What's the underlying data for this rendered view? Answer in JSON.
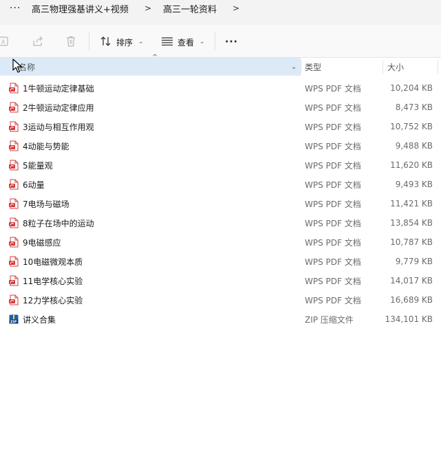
{
  "breadcrumb": {
    "more_label": "···",
    "items": [
      "高三物理强基讲义+视频",
      "高三一轮资料"
    ],
    "separator": ">"
  },
  "toolbar": {
    "sort_label": "排序",
    "view_label": "查看",
    "more_label": "···"
  },
  "columns": {
    "name": "名称",
    "type": "类型",
    "size": "大小"
  },
  "files": [
    {
      "name": "1牛顿运动定律基础",
      "type": "WPS PDF 文档",
      "size": "10,204 KB",
      "icon": "pdf-icon"
    },
    {
      "name": "2牛顿运动定律应用",
      "type": "WPS PDF 文档",
      "size": "8,473 KB",
      "icon": "pdf-icon"
    },
    {
      "name": "3运动与相互作用观",
      "type": "WPS PDF 文档",
      "size": "10,752 KB",
      "icon": "pdf-icon"
    },
    {
      "name": "4动能与势能",
      "type": "WPS PDF 文档",
      "size": "9,488 KB",
      "icon": "pdf-icon"
    },
    {
      "name": "5能量观",
      "type": "WPS PDF 文档",
      "size": "11,620 KB",
      "icon": "pdf-icon"
    },
    {
      "name": "6动量",
      "type": "WPS PDF 文档",
      "size": "9,493 KB",
      "icon": "pdf-icon"
    },
    {
      "name": "7电场与磁场",
      "type": "WPS PDF 文档",
      "size": "11,421 KB",
      "icon": "pdf-icon"
    },
    {
      "name": "8粒子在场中的运动",
      "type": "WPS PDF 文档",
      "size": "13,854 KB",
      "icon": "pdf-icon"
    },
    {
      "name": "9电磁感应",
      "type": "WPS PDF 文档",
      "size": "10,787 KB",
      "icon": "pdf-icon"
    },
    {
      "name": "10电磁微观本质",
      "type": "WPS PDF 文档",
      "size": "9,779 KB",
      "icon": "pdf-icon"
    },
    {
      "name": "11电学核心实验",
      "type": "WPS PDF 文档",
      "size": "14,017 KB",
      "icon": "pdf-icon"
    },
    {
      "name": "12力学核心实验",
      "type": "WPS PDF 文档",
      "size": "16,689 KB",
      "icon": "pdf-icon"
    },
    {
      "name": "讲义合集",
      "type": "ZIP 压缩文件",
      "size": "134,101 KB",
      "icon": "zip-icon"
    }
  ],
  "colors": {
    "pdf_red": "#d63b3b",
    "zip_blue": "#1f5fa8",
    "header_highlight": "#dceaf8"
  }
}
